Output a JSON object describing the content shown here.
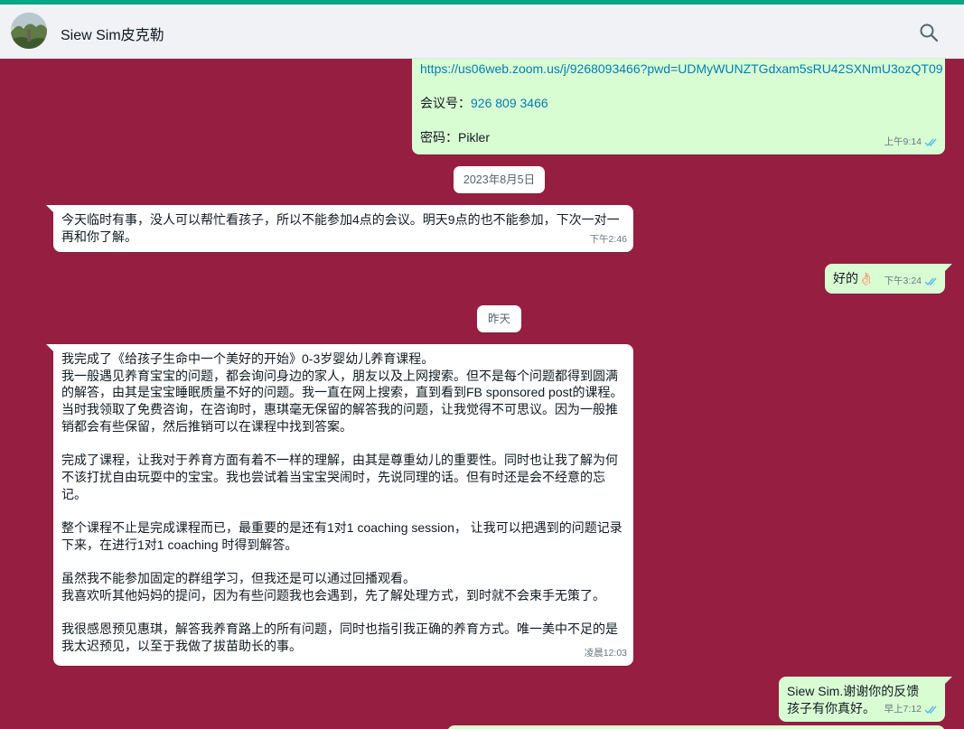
{
  "header": {
    "contact_name": "Siew Sim皮克勒",
    "search_icon": "search-icon"
  },
  "colors": {
    "chat_background": "#961f41",
    "accent_bar": "#00a884",
    "incoming_bubble": "#ffffff",
    "outgoing_bubble": "#d9fdd3",
    "link": "#027eb5",
    "read_ticks": "#53bdeb"
  },
  "messages": {
    "zoom": {
      "link": "https://us06web.zoom.us/j/9268093466?pwd=UDMyWUNZTGdxam5sRU42SXNmU3ozQT09",
      "meeting_label": "会议号：",
      "meeting_id": "926 809 3466",
      "password_line": "密码：Pikler",
      "time": "上午9:14"
    },
    "date_1": "2023年8月5日",
    "msg_busy": {
      "text": "今天临时有事，没人可以帮忙看孩子，所以不能参加4点的会议。明天9点的也不能参加，下次一对一再和你了解。",
      "time": "下午2:46"
    },
    "msg_ok": {
      "text": "好的👌🏻",
      "time": "下午3:24"
    },
    "date_2": "昨天",
    "msg_review": {
      "text": "我完成了《给孩子生命中一个美好的开始》0-3岁婴幼儿养育课程。\n我一般遇见养育宝宝的问题，都会询问身边的家人，朋友以及上网搜索。但不是每个问题都得到圆满的解答，由其是宝宝睡眠质量不好的问题。我一直在网上搜索，直到看到FB sponsored post的课程。当时我领取了免费咨询，在咨询时，惠琪毫无保留的解答我的问题，让我觉得不可思议。因为一般推销都会有些保留，然后推销可以在课程中找到答案。\n\n完成了课程，让我对于养育方面有着不一样的理解，由其是尊重幼儿的重要性。同时也让我了解为何不该打扰自由玩耍中的宝宝。我也尝试着当宝宝哭闹时，先说同理的话。但有时还是会不经意的忘记。\n\n整个课程不止是完成课程而已，最重要的是还有1对1 coaching session， 让我可以把遇到的问题记录下来，在进行1对1 coaching 时得到解答。\n\n虽然我不能参加固定的群组学习，但我还是可以通过回播观看。\n我喜欢听其他妈妈的提问，因为有些问题我也会遇到，先了解处理方式，到时就不会束手无策了。\n\n我很感恩预见惠琪，解答我养育路上的所有问题，同时也指引我正确的养育方式。唯一美中不足的是我太迟预见，以至于我做了拔苗助长的事。",
      "time": "凌晨12:03"
    },
    "msg_thanks": {
      "text": "Siew Sim.谢谢你的反馈\n孩子有你真好。",
      "time": "早上7:12"
    }
  }
}
